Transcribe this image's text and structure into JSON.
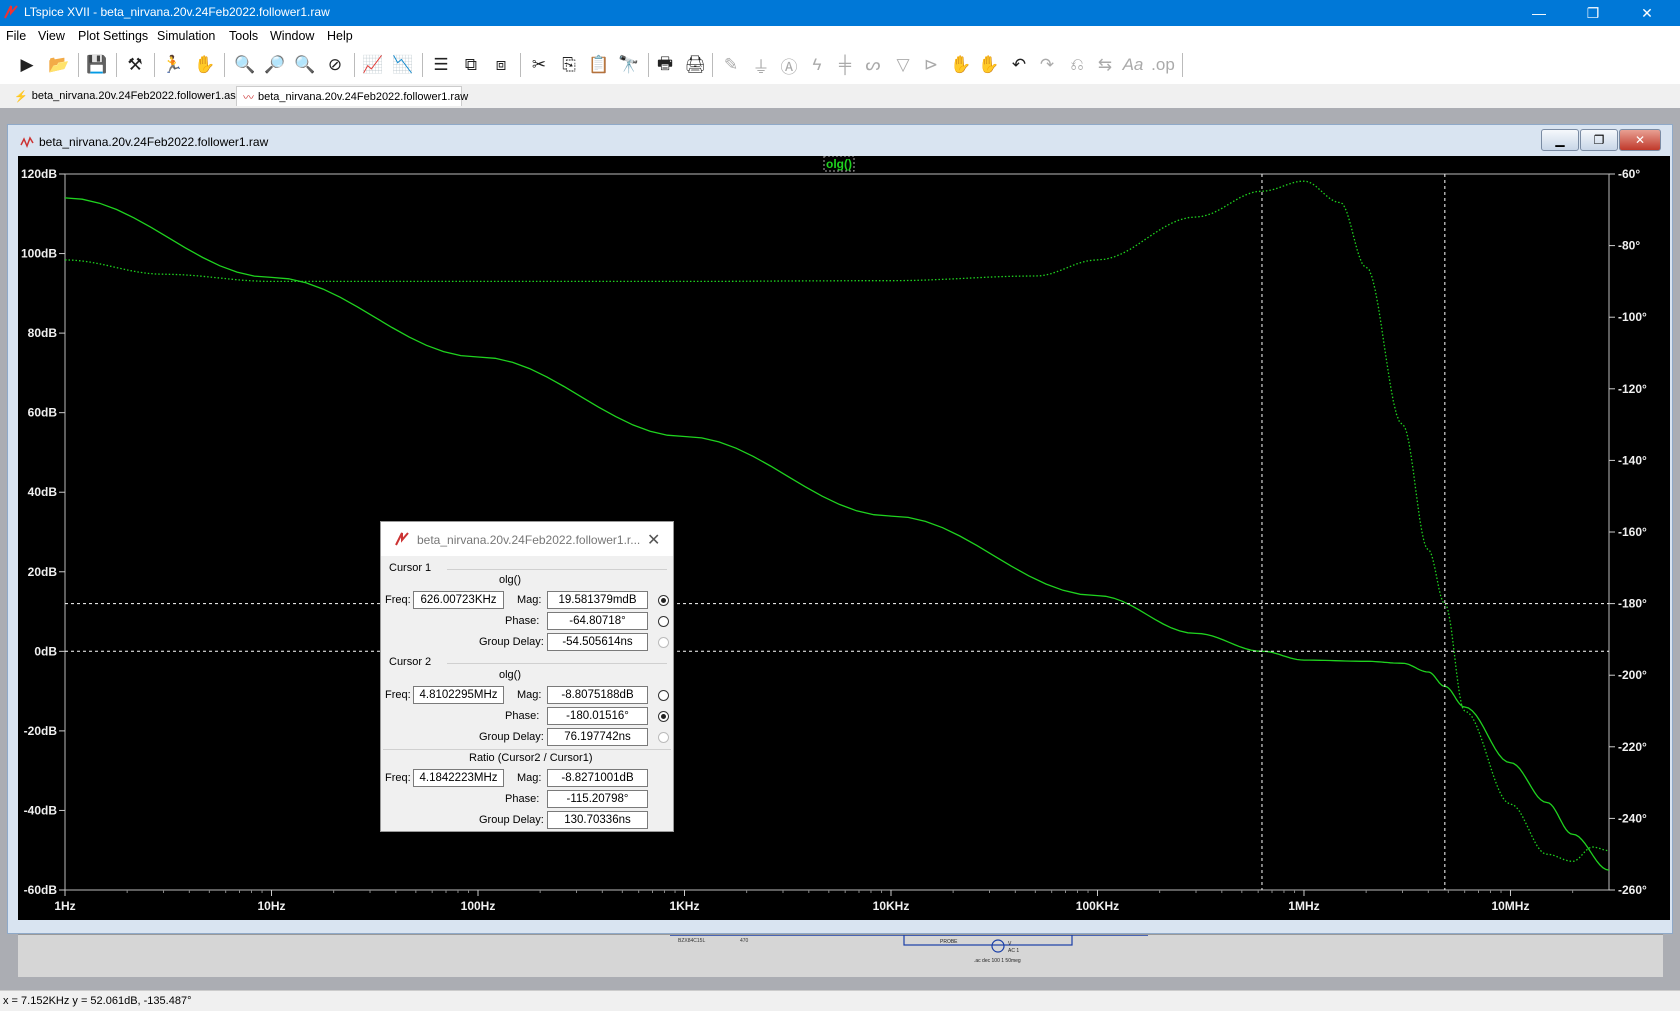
{
  "window": {
    "title": "LTspice XVII - beta_nirvana.20v.24Feb2022.follower1.raw"
  },
  "menu": [
    "File",
    "View",
    "Plot Settings",
    "Simulation",
    "Tools",
    "Window",
    "Help"
  ],
  "tabs": [
    {
      "label": "beta_nirvana.20v.24Feb2022.follower1.asc",
      "active": false
    },
    {
      "label": "beta_nirvana.20v.24Feb2022.follower1.raw",
      "active": true
    }
  ],
  "plot_window": {
    "title": "beta_nirvana.20v.24Feb2022.follower1.raw",
    "trace_label": "olg()",
    "background": "#000000",
    "trace_color": "#1fd21f",
    "cursor_color": "#ffffff"
  },
  "chart_data": {
    "type": "line",
    "x_scale": "log",
    "x_range_hz": [
      1,
      30000000
    ],
    "xticks": [
      "1Hz",
      "10Hz",
      "100Hz",
      "1KHz",
      "10KHz",
      "100KHz",
      "1MHz",
      "10MHz"
    ],
    "left_axis": {
      "unit": "dB",
      "range": [
        -60,
        120
      ],
      "ticks": [
        "120dB",
        "100dB",
        "80dB",
        "60dB",
        "40dB",
        "20dB",
        "0dB",
        "-20dB",
        "-40dB",
        "-60dB"
      ]
    },
    "right_axis": {
      "unit": "°",
      "range": [
        -260,
        -60
      ],
      "ticks": [
        "-60°",
        "-80°",
        "-100°",
        "-120°",
        "-140°",
        "-160°",
        "-180°",
        "-200°",
        "-220°",
        "-240°",
        "-260°"
      ]
    },
    "series": [
      {
        "name": "olg()",
        "quantity": "magnitude_dB",
        "style": "solid",
        "points": [
          [
            1,
            114
          ],
          [
            10,
            94
          ],
          [
            100,
            74
          ],
          [
            1000,
            54
          ],
          [
            10000,
            34
          ],
          [
            100000,
            14
          ],
          [
            300000,
            4.5
          ],
          [
            626007,
            0.02
          ],
          [
            1000000,
            -2.2
          ],
          [
            2000000,
            -2.5
          ],
          [
            3000000,
            -3
          ],
          [
            4000000,
            -5.2
          ],
          [
            4810230,
            -8.8
          ],
          [
            6000000,
            -14
          ],
          [
            10000000,
            -28
          ],
          [
            15000000,
            -38
          ],
          [
            20000000,
            -46
          ],
          [
            30000000,
            -55
          ]
        ]
      },
      {
        "name": "olg()",
        "quantity": "phase_deg",
        "style": "dotted",
        "points": [
          [
            1,
            -84
          ],
          [
            3,
            -88
          ],
          [
            10,
            -90
          ],
          [
            1000,
            -90
          ],
          [
            10000,
            -89.8
          ],
          [
            50000,
            -88.5
          ],
          [
            100000,
            -84
          ],
          [
            300000,
            -72
          ],
          [
            626007,
            -64.8
          ],
          [
            1000000,
            -62
          ],
          [
            1500000,
            -68
          ],
          [
            2000000,
            -86
          ],
          [
            3000000,
            -130
          ],
          [
            4000000,
            -165
          ],
          [
            4810230,
            -180.02
          ],
          [
            6000000,
            -210
          ],
          [
            10000000,
            -236
          ],
          [
            15000000,
            -250
          ],
          [
            20000000,
            -252
          ],
          [
            25000000,
            -248
          ],
          [
            30000000,
            -249
          ]
        ]
      }
    ],
    "cursors": [
      {
        "freq_hz": 626007,
        "level_db": 0.02
      },
      {
        "freq_hz": 4810230,
        "level_deg": -180.02
      }
    ]
  },
  "cursor_dialog": {
    "title": "beta_nirvana.20v.24Feb2022.follower1.r...",
    "cursor1": {
      "header": "Cursor 1",
      "trace": "olg()",
      "freq_label": "Freq:",
      "freq": "626.00723KHz",
      "mag_label": "Mag:",
      "mag": "19.581379mdB",
      "phase_label": "Phase:",
      "phase": "-64.80718°",
      "gd_label": "Group Delay:",
      "gd": "-54.505614ns"
    },
    "cursor2": {
      "header": "Cursor 2",
      "trace": "olg()",
      "freq_label": "Freq:",
      "freq": "4.8102295MHz",
      "mag_label": "Mag:",
      "mag": "-8.8075188dB",
      "phase_label": "Phase:",
      "phase": "-180.01516°",
      "gd_label": "Group Delay:",
      "gd": "76.197742ns"
    },
    "ratio": {
      "header": "Ratio (Cursor2 / Cursor1)",
      "freq_label": "Freq:",
      "freq": "4.1842223MHz",
      "mag_label": "Mag:",
      "mag": "-8.8271001dB",
      "phase_label": "Phase:",
      "phase": "-115.20798°",
      "gd_label": "Group Delay:",
      "gd": "130.70336ns"
    }
  },
  "schematic_strip": {
    "probe_label": "PROBE",
    "source_label": "V",
    "ac_label": "AC 1",
    "directive": ".ac dec 100 1 50meg"
  },
  "status": {
    "text": "x = 7.152KHz    y = 52.061dB, -135.487°"
  }
}
